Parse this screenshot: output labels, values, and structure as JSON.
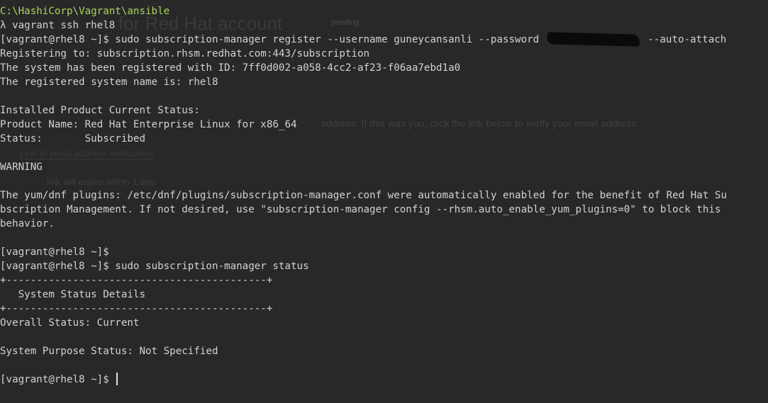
{
  "background_ghost": {
    "title": "for Red Hat account",
    "badge": "pending",
    "message": "address. If this was you, click the link below to verify your email address.",
    "link": "Link to email address verification",
    "expiry": "link will expire within 1 day."
  },
  "terminal": {
    "cwd": "C:\\HashiCorp\\Vagrant\\ansible",
    "lines": [
      "λ vagrant ssh rhel8",
      "[vagrant@rhel8 ~]$ sudo subscription-manager register --username guneycansanli --password",
      "--auto-attach",
      "Registering to: subscription.rhsm.redhat.com:443/subscription",
      "The system has been registered with ID: 7ff0d002-a058-4cc2-af23-f06aa7ebd1a0",
      "The registered system name is: rhel8",
      "",
      "Installed Product Current Status:",
      "Product Name: Red Hat Enterprise Linux for x86_64",
      "Status:       Subscribed",
      "",
      "WARNING",
      "",
      "The yum/dnf plugins: /etc/dnf/plugins/subscription-manager.conf were automatically enabled for the benefit of Red Hat Su",
      "bscription Management. If not desired, use \"subscription-manager config --rhsm.auto_enable_yum_plugins=0\" to block this",
      "behavior.",
      "",
      "[vagrant@rhel8 ~]$",
      "[vagrant@rhel8 ~]$ sudo subscription-manager status",
      "+-------------------------------------------+",
      "   System Status Details",
      "+-------------------------------------------+",
      "Overall Status: Current",
      "",
      "System Purpose Status: Not Specified",
      "",
      "[vagrant@rhel8 ~]$"
    ]
  }
}
